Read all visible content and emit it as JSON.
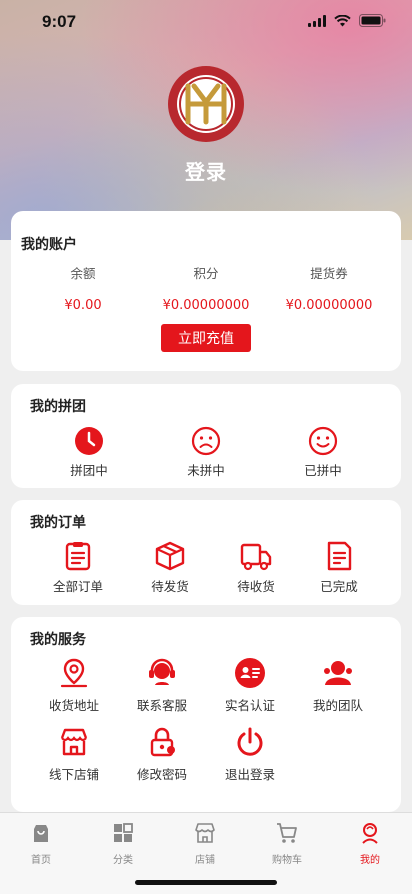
{
  "status_bar": {
    "time": "9:07"
  },
  "header": {
    "login_label": "登录"
  },
  "account": {
    "title": "我的账户",
    "balance_label": "余额",
    "balance_value": "¥0.00",
    "points_label": "积分",
    "points_value": "¥0.00000000",
    "voucher_label": "提货券",
    "voucher_value": "¥0.00000000",
    "recharge_label": "立即充值"
  },
  "group_buy": {
    "title": "我的拼团",
    "items": [
      {
        "label": "拼团中",
        "icon": "clock-icon"
      },
      {
        "label": "未拼中",
        "icon": "sad-face-icon"
      },
      {
        "label": "已拼中",
        "icon": "smile-face-icon"
      }
    ]
  },
  "orders": {
    "title": "我的订单",
    "items": [
      {
        "label": "全部订单",
        "icon": "order-list-icon"
      },
      {
        "label": "待发货",
        "icon": "package-icon"
      },
      {
        "label": "待收货",
        "icon": "truck-icon"
      },
      {
        "label": "已完成",
        "icon": "completed-doc-icon"
      }
    ]
  },
  "services": {
    "title": "我的服务",
    "items": [
      {
        "label": "收货地址",
        "icon": "map-pin-icon"
      },
      {
        "label": "联系客服",
        "icon": "headset-icon"
      },
      {
        "label": "实名认证",
        "icon": "id-card-icon"
      },
      {
        "label": "我的团队",
        "icon": "team-icon"
      },
      {
        "label": "线下店铺",
        "icon": "store-icon"
      },
      {
        "label": "修改密码",
        "icon": "lock-icon"
      },
      {
        "label": "退出登录",
        "icon": "power-icon"
      }
    ]
  },
  "tabbar": {
    "items": [
      {
        "label": "首页",
        "icon": "shopping-bag-icon"
      },
      {
        "label": "分类",
        "icon": "grid-icon"
      },
      {
        "label": "店铺",
        "icon": "shop-icon"
      },
      {
        "label": "购物车",
        "icon": "cart-icon"
      },
      {
        "label": "我的",
        "icon": "profile-icon"
      }
    ],
    "active": "我的"
  },
  "colors": {
    "accent": "#e4161c",
    "background": "#efefef",
    "card": "#ffffff",
    "logo_red": "#b8282e"
  }
}
